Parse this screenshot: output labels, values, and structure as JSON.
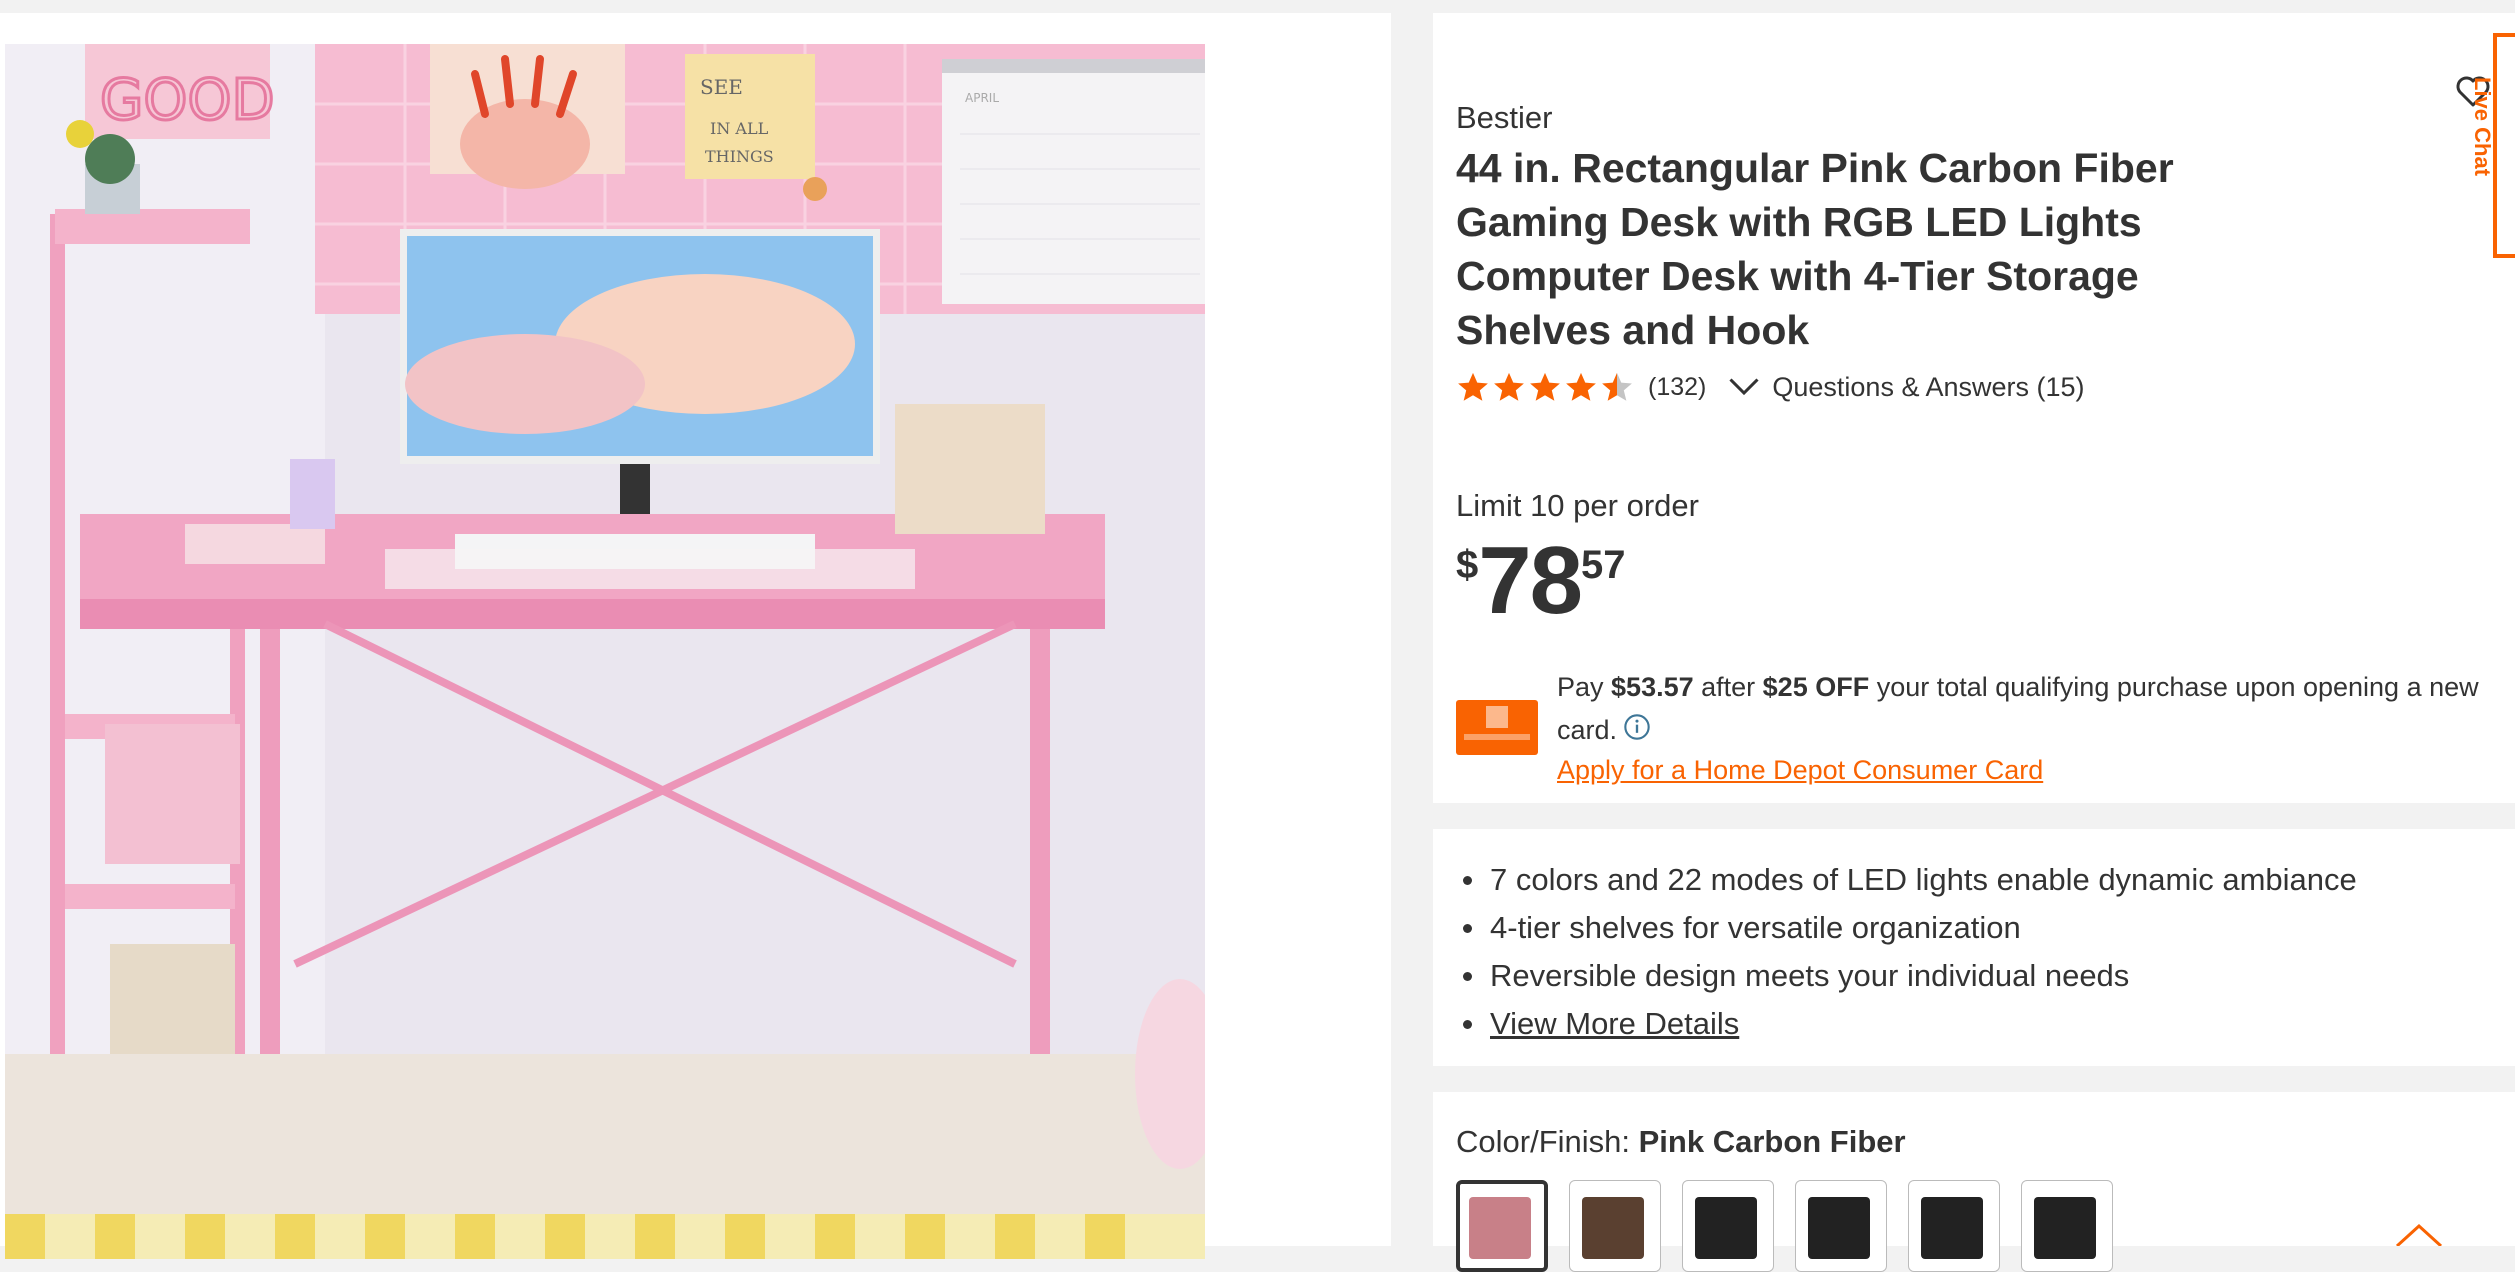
{
  "product": {
    "brand": "Bestier",
    "title": "44 in. Rectangular Pink Carbon Fiber Gaming Desk with RGB LED Lights Computer Desk with 4-Tier Storage Shelves and Hook",
    "rating": 4.5,
    "review_count": "(132)",
    "qa_label": "Questions & Answers (15)",
    "limit": "Limit 10 per order",
    "price": {
      "currency": "$",
      "dollars": "78",
      "cents": "57"
    }
  },
  "promo": {
    "pay": "Pay ",
    "amount": "$53.57",
    "after": " after ",
    "discount": "$25 OFF",
    "rest": " your total qualifying purchase upon opening a new card.",
    "apply_link": "Apply for a Home Depot Consumer Card"
  },
  "highlights": [
    "7 colors and 22 modes of LED lights enable dynamic ambiance",
    "4-tier shelves for versatile organization",
    "Reversible design meets your individual needs",
    "View More Details"
  ],
  "color_finish": {
    "label": "Color/Finish: ",
    "selected": "Pink Carbon Fiber",
    "swatches": [
      "#c88088",
      "#5a4030",
      "#222222",
      "#222222",
      "#222222",
      "#222222"
    ]
  },
  "live_chat": "Live Chat",
  "image_text": {
    "sign_good": "GOOD",
    "note_line1": "SEE",
    "note_line2": "IN ALL",
    "note_line3": "THINGS",
    "calendar_month": "APRIL"
  },
  "colors": {
    "accent": "#f96302",
    "desk_pink": "#f2a6c4",
    "wall_pink": "#f4b8cf",
    "star": "#f96302",
    "text": "#333333"
  }
}
